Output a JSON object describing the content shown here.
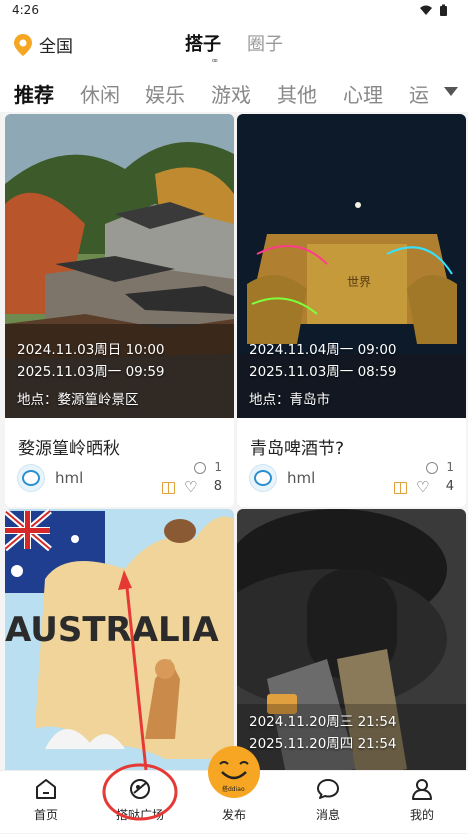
{
  "status": {
    "time": "4:26"
  },
  "header": {
    "location": "全国",
    "tabs": [
      {
        "label": "搭子",
        "active": true
      },
      {
        "label": "圈子",
        "active": false
      }
    ],
    "loading_mark": "ꟹ"
  },
  "categories": [
    "推荐",
    "休闲",
    "娱乐",
    "游戏",
    "其他",
    "心理",
    "运"
  ],
  "cards": [
    {
      "start": "2024.11.03周日 10:00",
      "end": "2025.11.03周一 09:59",
      "place": "地点：婺源篁岭景区",
      "title": "婺源篁岭晒秋",
      "author": "hml",
      "coins": "1",
      "likes": "8"
    },
    {
      "start": "2024.11.04周一 09:00",
      "end": "2025.11.03周一 08:59",
      "place": "地点：青岛市",
      "title": "青岛啤酒节?",
      "author": "hml",
      "coins": "1",
      "likes": "4"
    },
    {
      "start": "2024.11.20周三 21:54",
      "end": "2025.11.20周四 21:54",
      "partial_start": "2024.11.20周三 21:54"
    }
  ],
  "card3_partial": "2024.11.20周三 21:54",
  "card4": {
    "start": "2024.11.20周三 21:54",
    "end": "2025.11.20周四 21:54"
  },
  "card3_text": "AUSTRALIA",
  "card2_text": "世界",
  "publish_badge": "搭ddiao",
  "nav": {
    "home": "首页",
    "plaza": "搭哒广场",
    "publish": "发布",
    "messages": "消息",
    "mine": "我的"
  },
  "colors": {
    "accent": "#f6a623",
    "pin": "#f5a623",
    "annotation": "#e53935"
  }
}
